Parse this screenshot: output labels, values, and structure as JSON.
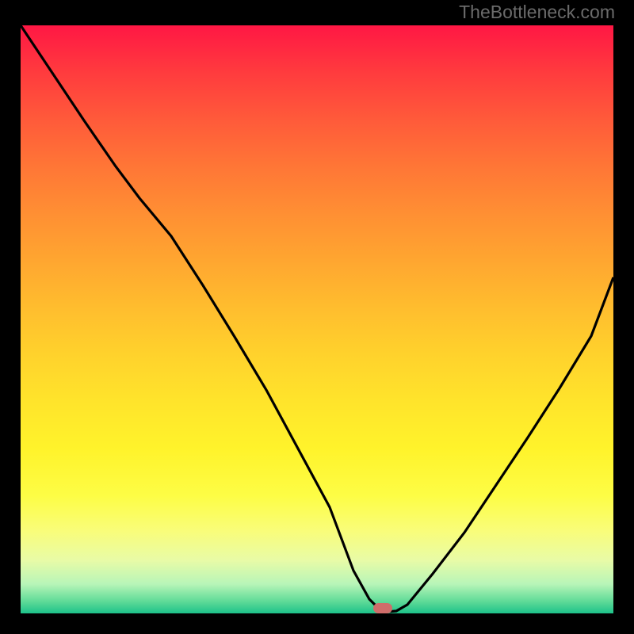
{
  "watermark": "TheBottleneck.com",
  "colors": {
    "frame": "#000000",
    "watermark_text": "#6b6b6b",
    "curve_stroke": "#000000",
    "marker": "#cf6d6a",
    "gradient_top": "#ff1744",
    "gradient_bottom": "#1dc28a"
  },
  "chart_data": {
    "type": "line",
    "title": "",
    "xlabel": "",
    "ylabel": "",
    "xlim": [
      0,
      100
    ],
    "ylim": [
      0,
      100
    ],
    "grid": false,
    "x": [
      0,
      5,
      10,
      15,
      20,
      25,
      30,
      35,
      40,
      45,
      50,
      55,
      57,
      60,
      62,
      64,
      70,
      75,
      80,
      85,
      90,
      95,
      100
    ],
    "values": [
      100,
      92,
      84,
      76,
      71,
      64,
      56,
      47,
      38,
      28,
      18,
      8,
      2,
      0,
      0,
      1,
      7,
      14,
      22,
      30,
      39,
      48,
      57
    ],
    "marker": {
      "x": 61,
      "y": 0
    },
    "background": "rainbow-vertical-gradient"
  }
}
